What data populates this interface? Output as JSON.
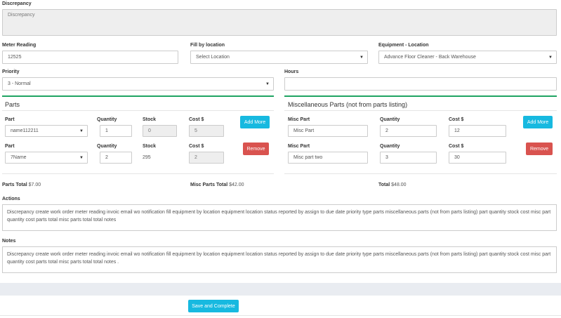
{
  "discrepancy": {
    "label": "Discrepancy",
    "value": "Discrepancy"
  },
  "meter_reading": {
    "label": "Meter Reading",
    "value": "12525"
  },
  "fill_by_location": {
    "label": "Fill by location",
    "value": "Select Location"
  },
  "equipment_location": {
    "label": "Equipment - Location",
    "value": "Advance Floor Cleaner - Back Warehouse"
  },
  "priority": {
    "label": "Priority",
    "value": "3 - Normal"
  },
  "hours": {
    "label": "Hours",
    "value": ""
  },
  "parts": {
    "title": "Parts",
    "headers": {
      "part": "Part",
      "quantity": "Quantity",
      "stock": "Stock",
      "cost": "Cost $"
    },
    "rows": [
      {
        "part": "name112211",
        "quantity": "1",
        "stock": "0",
        "cost": "5",
        "button": "Add More"
      },
      {
        "part": "7Name",
        "quantity": "2",
        "stock": "295",
        "cost": "2",
        "button": "Remove"
      }
    ]
  },
  "misc_parts": {
    "title": "Miscellaneous Parts (not from parts listing)",
    "headers": {
      "part": "Misc Part",
      "quantity": "Quantity",
      "cost": "Cost $"
    },
    "rows": [
      {
        "part": "Misc Part",
        "quantity": "2",
        "cost": "12",
        "button": "Add More"
      },
      {
        "part": "Misc part two",
        "quantity": "3",
        "cost": "30",
        "button": "Remove"
      }
    ]
  },
  "totals": {
    "parts_label": "Parts Total",
    "parts_value": "$7.00",
    "misc_label": "Misc Parts Total",
    "misc_value": "$42.00",
    "total_label": "Total",
    "total_value": "$48.00"
  },
  "actions": {
    "label": "Actions",
    "value": "Discrepancy create work order meter reading invoic email wo notification fill equipment by location equipment location status reported by assign to due date priority type parts miscellaneous parts (not from parts listing) part quantity stock cost misc part quantity cost parts total misc parts total total notes"
  },
  "notes": {
    "label": "Notes",
    "value": "Discrepancy create work order meter reading invoic email wo notification fill equipment by location equipment location status reported by assign to due date priority type parts miscellaneous parts (not from parts listing) part quantity stock cost misc part quantity cost parts total misc parts total total notes ."
  },
  "save_button": "Save and Complete",
  "colors": {
    "accent": "#17b9e0",
    "danger": "#d9534f",
    "divider": "#1fa463"
  }
}
